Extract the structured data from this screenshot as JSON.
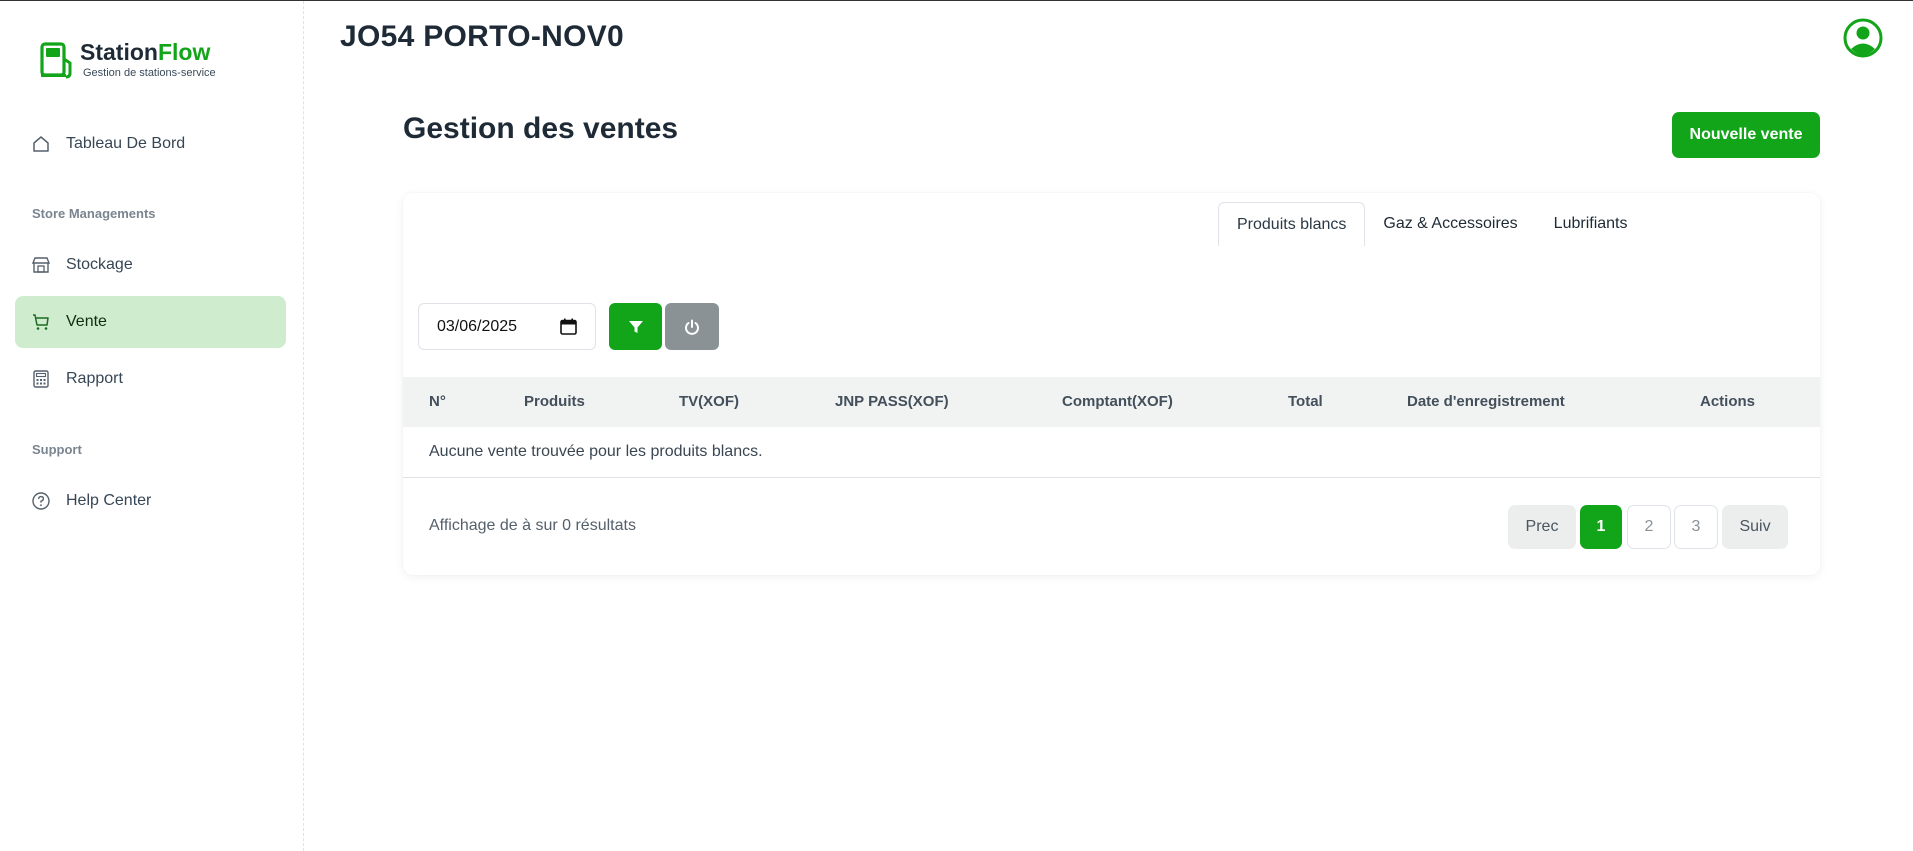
{
  "brand": {
    "title_part1": "Station",
    "title_part2": "Flow",
    "subtitle": "Gestion de stations-service",
    "accent": "#12a51a"
  },
  "sidebar": {
    "items": [
      {
        "label": "Tableau De Bord",
        "icon": "home-icon"
      },
      {
        "label": "Stockage",
        "icon": "store-icon"
      },
      {
        "label": "Vente",
        "icon": "cart-icon",
        "active": true
      },
      {
        "label": "Rapport",
        "icon": "calculator-icon"
      },
      {
        "label": "Help Center",
        "icon": "help-circle-icon"
      }
    ],
    "section_store": "Store Managements",
    "section_support": "Support"
  },
  "header": {
    "station": "JO54 PORTO-NOV0",
    "avatar_icon": "user-circle-icon"
  },
  "main": {
    "title": "Gestion des ventes",
    "new_button": "Nouvelle vente",
    "tabs": [
      {
        "label": "Produits blancs",
        "active": true
      },
      {
        "label": "Gaz & Accessoires"
      },
      {
        "label": "Lubrifiants"
      }
    ],
    "filter": {
      "date_value": "03/06/2025",
      "filter_icon": "funnel-icon",
      "reset_icon": "power-icon"
    },
    "table": {
      "columns": [
        "N°",
        "Produits",
        "TV(XOF)",
        "JNP PASS(XOF)",
        "Comptant(XOF)",
        "Total",
        "Date d'enregistrement",
        "Actions"
      ],
      "empty_message": "Aucune vente trouvée pour les produits blancs."
    },
    "footer": {
      "info": "Affichage de à sur 0 résultats",
      "prev": "Prec",
      "pages": [
        "1",
        "2",
        "3"
      ],
      "current_page": "1",
      "next": "Suiv"
    }
  }
}
